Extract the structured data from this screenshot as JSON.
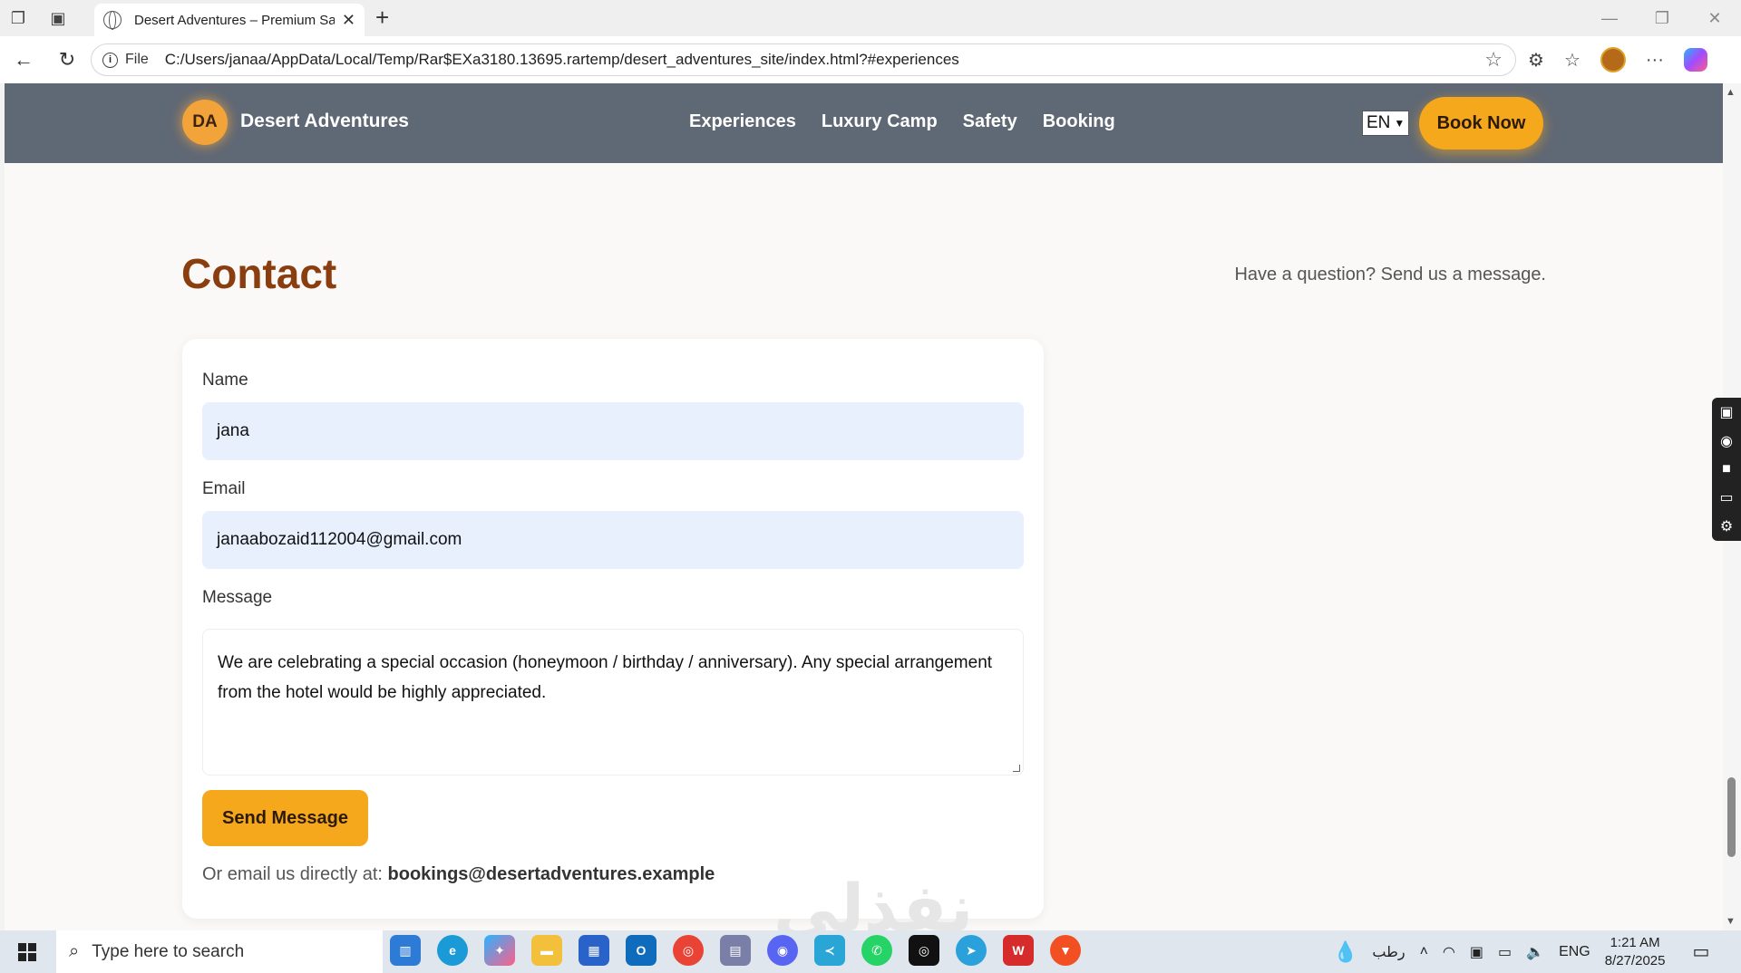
{
  "browser": {
    "tab_title": "Desert Adventures – Premium Sa",
    "file_label": "File",
    "url": "C:/Users/janaa/AppData/Local/Temp/Rar$EXa3180.13695.rartemp/desert_adventures_site/index.html?#experiences"
  },
  "site": {
    "logo_initials": "DA",
    "brand": "Desert Adventures",
    "nav": [
      "Experiences",
      "Luxury Camp",
      "Safety",
      "Booking"
    ],
    "language": "EN",
    "book_now": "Book Now"
  },
  "contact": {
    "title": "Contact",
    "subtitle": "Have a question? Send us a message.",
    "name_label": "Name",
    "name_value": "jana",
    "email_label": "Email",
    "email_value": "janaabozaid112004@gmail.com",
    "message_label": "Message",
    "message_value": "We are celebrating a special occasion (honeymoon / birthday / anniversary). Any special arrangement from the hotel would be highly appreciated.",
    "send_label": "Send Message",
    "direct_prefix": "Or email us directly at:",
    "direct_email": "bookings@desertadventures.example"
  },
  "watermark": "نفذلي",
  "taskbar": {
    "search_placeholder": "Type here to search",
    "weather_text": "رطب",
    "language": "ENG",
    "time": "1:21 AM",
    "date": "8/27/2025"
  },
  "colors": {
    "header_bg": "#5f6875",
    "accent": "#f6a81c",
    "title": "#8a3e0f"
  }
}
